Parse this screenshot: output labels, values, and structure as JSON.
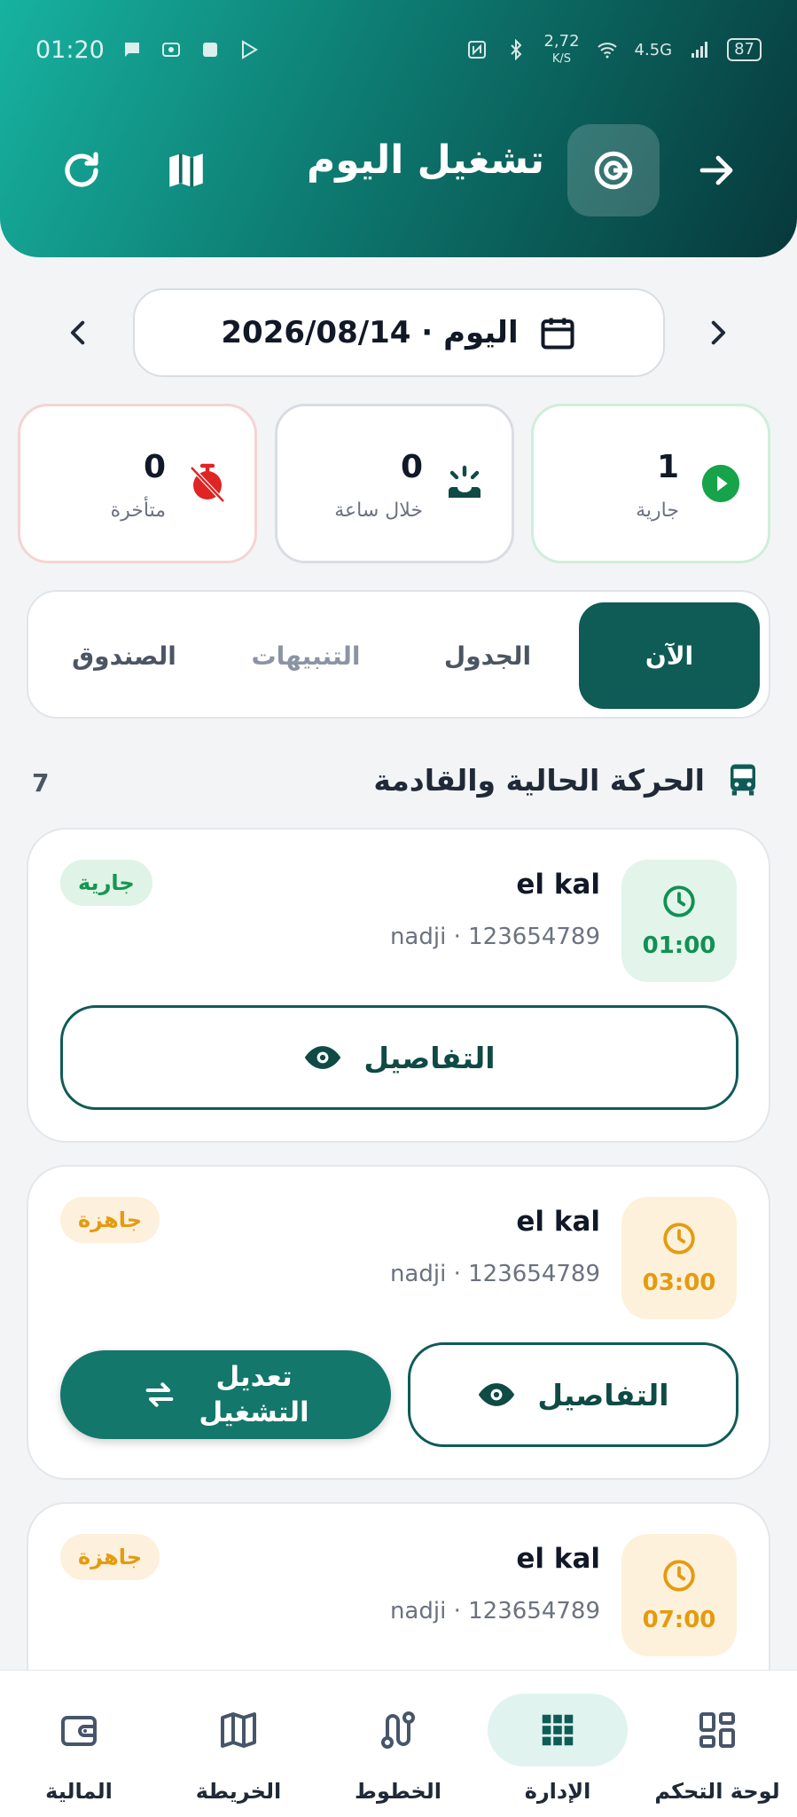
{
  "status_bar": {
    "time": "01:20",
    "net_speed": "2,72",
    "net_unit": "K/S",
    "network": "4.5G",
    "battery": "87"
  },
  "header": {
    "title": "تشغيل اليوم"
  },
  "date_selector": {
    "label": "2026/08/14 · اليوم"
  },
  "stats": {
    "running": {
      "value": "1",
      "label": "جارية"
    },
    "within_hour": {
      "value": "0",
      "label": "خلال ساعة"
    },
    "late": {
      "value": "0",
      "label": "متأخرة"
    }
  },
  "tabs": [
    "الآن",
    "الجدول",
    "التنبيهات",
    "الصندوق"
  ],
  "section": {
    "title": "الحركة الحالية والقادمة",
    "count": "7"
  },
  "trips": [
    {
      "time": "01:00",
      "name": "el kal",
      "sub": "nadji · 123654789",
      "status": "جارية",
      "details_label": "التفاصيل"
    },
    {
      "time": "03:00",
      "name": "el kal",
      "sub": "nadji · 123654789",
      "status": "جاهزة",
      "details_label": "التفاصيل",
      "edit_label_line1": "تعديل",
      "edit_label_line2": "التشغيل"
    },
    {
      "time": "07:00",
      "name": "el kal",
      "sub": "nadji · 123654789",
      "status": "جاهزة"
    }
  ],
  "bottom_nav": [
    {
      "label": "لوحة التحكم",
      "icon": "dashboard-icon"
    },
    {
      "label": "الإدارة",
      "icon": "grid-icon",
      "active": true
    },
    {
      "label": "الخطوط",
      "icon": "route-icon"
    },
    {
      "label": "الخريطة",
      "icon": "map-icon"
    },
    {
      "label": "المالية",
      "icon": "wallet-icon"
    }
  ],
  "colors": {
    "primary": "#0f5b56",
    "accent_green": "#119155",
    "accent_amber": "#e49b0f",
    "alert_red": "#e02424"
  }
}
